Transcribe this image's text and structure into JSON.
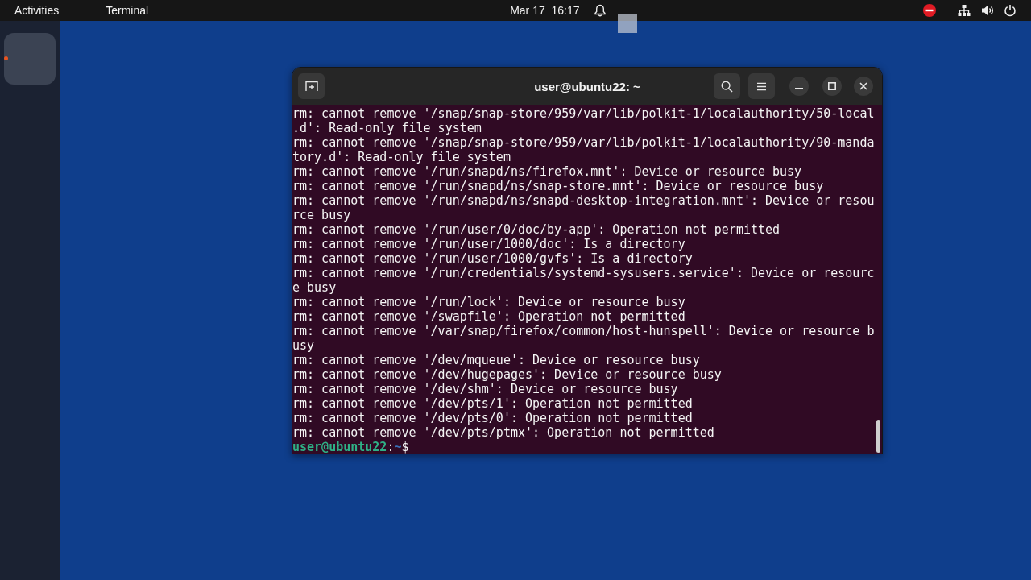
{
  "top_bar": {
    "activities": "Activities",
    "app_menu": "Terminal",
    "clock": "Mar 17  16:17"
  },
  "dock": {
    "items": [
      {
        "selected": true,
        "running": true
      }
    ]
  },
  "terminal": {
    "title": "user@ubuntu22: ~",
    "lines": [
      "rm: cannot remove '/snap/snap-store/959/var/lib/polkit-1/localauthority/50-local.d': Read-only file system",
      "rm: cannot remove '/snap/snap-store/959/var/lib/polkit-1/localauthority/90-mandatory.d': Read-only file system",
      "rm: cannot remove '/run/snapd/ns/firefox.mnt': Device or resource busy",
      "rm: cannot remove '/run/snapd/ns/snap-store.mnt': Device or resource busy",
      "rm: cannot remove '/run/snapd/ns/snapd-desktop-integration.mnt': Device or resource busy",
      "rm: cannot remove '/run/user/0/doc/by-app': Operation not permitted",
      "rm: cannot remove '/run/user/1000/doc': Is a directory",
      "rm: cannot remove '/run/user/1000/gvfs': Is a directory",
      "rm: cannot remove '/run/credentials/systemd-sysusers.service': Device or resource busy",
      "rm: cannot remove '/run/lock': Device or resource busy",
      "rm: cannot remove '/swapfile': Operation not permitted",
      "rm: cannot remove '/var/snap/firefox/common/host-hunspell': Device or resource busy",
      "rm: cannot remove '/dev/mqueue': Device or resource busy",
      "rm: cannot remove '/dev/hugepages': Device or resource busy",
      "rm: cannot remove '/dev/shm': Device or resource busy",
      "rm: cannot remove '/dev/pts/1': Operation not permitted",
      "rm: cannot remove '/dev/pts/0': Operation not permitted",
      "rm: cannot remove '/dev/pts/ptmx': Operation not permitted"
    ],
    "prompt": {
      "user_host": "user@ubuntu22",
      "separator": ":",
      "path": "~",
      "symbol": "$"
    }
  }
}
